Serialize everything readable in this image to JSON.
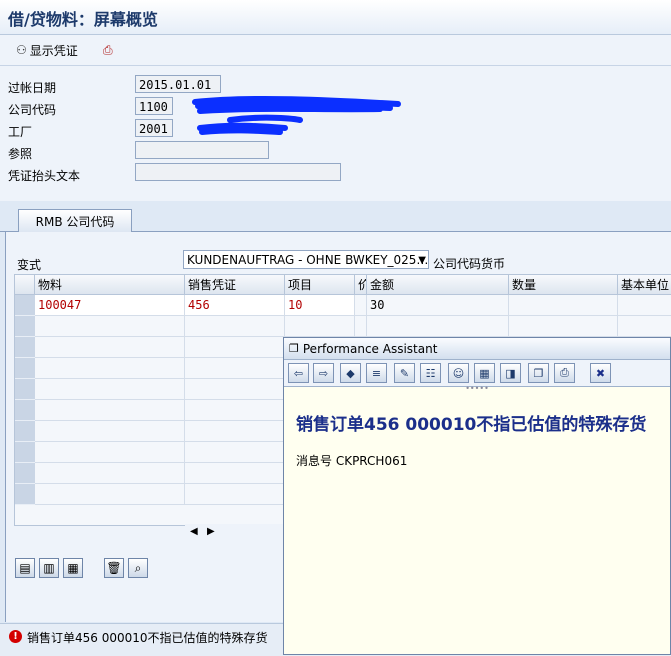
{
  "window": {
    "title": "借/贷物料：屏幕概览"
  },
  "toolbar": {
    "show_doc_label": "显示凭证",
    "show_doc_icon": "glasses-icon",
    "extra_icon": "print-icon"
  },
  "header_form": {
    "posting_date_label": "过帐日期",
    "posting_date_value": "2015.01.01",
    "company_code_label": "公司代码",
    "company_code_value": "1100",
    "plant_label": "工厂",
    "plant_value": "2001",
    "reference_label": "参照",
    "reference_value": "",
    "doc_header_text_label": "凭证抬头文本",
    "doc_header_text_value": ""
  },
  "tabs": [
    {
      "label": "RMB 公司代码"
    }
  ],
  "variant": {
    "label": "变式",
    "selected": "KUNDENAUFTRAG - OHNE BWKEY_025…",
    "currency_label": "公司代码货币"
  },
  "grid": {
    "columns": [
      "物料",
      "销售凭证",
      "项目",
      "价",
      "金额",
      "数量",
      "基本单位"
    ],
    "rows": [
      {
        "material": "100047",
        "sales_doc": "456",
        "item": "10",
        "price": "",
        "amount": "30",
        "qty": "",
        "unit": ""
      }
    ]
  },
  "status": {
    "message": "销售订单456 000010不指已估值的特殊存货"
  },
  "performance_assistant": {
    "title": "Performance Assistant",
    "heading": "销售订单456 000010不指已估值的特殊存货",
    "message_no": "消息号 CKPRCH061"
  },
  "colors": {
    "accent": "#1d3a6b",
    "error": "#d40000",
    "heading": "#1b2f8a",
    "value_red": "#b20000"
  }
}
